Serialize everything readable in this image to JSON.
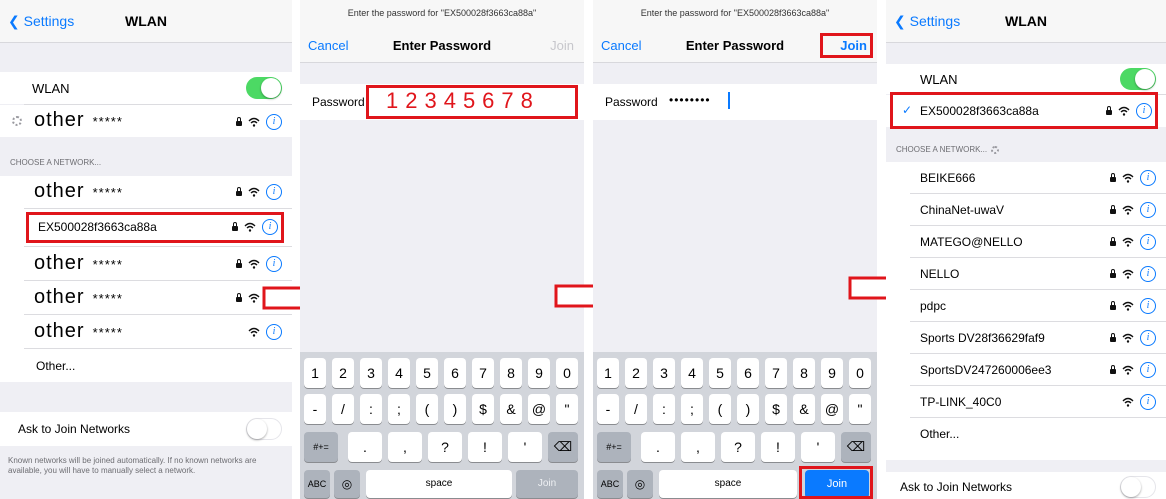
{
  "colors": {
    "accent": "#0a7aff",
    "switch_on": "#4cd964",
    "highlight": "#e0151b",
    "keyboard_bg": "#d2d5db"
  },
  "panel1": {
    "back_label": "Settings",
    "title": "WLAN",
    "wlan_label": "WLAN",
    "current_network_word": "other",
    "current_network_stars": "*****",
    "section_label": "CHOOSE A NETWORK...",
    "networks": [
      {
        "word": "other",
        "stars": "*****"
      },
      {
        "name": "EX500028f3663ca88a"
      },
      {
        "word": "other",
        "stars": "*****"
      },
      {
        "word": "other",
        "stars": "*****"
      },
      {
        "word": "other",
        "stars": "*****"
      }
    ],
    "other_label": "Other...",
    "ask_join_label": "Ask to Join Networks",
    "footnote": "Known networks will be joined automatically. If no known networks are available, you will have to manually select a network."
  },
  "panel2": {
    "prompt": "Enter the password for \"EX500028f3663ca88a\"",
    "cancel_label": "Cancel",
    "title": "Enter Password",
    "join_label": "Join",
    "password_label": "Password",
    "password_value": "12345678",
    "keys_row1": [
      "1",
      "2",
      "3",
      "4",
      "5",
      "6",
      "7",
      "8",
      "9",
      "0"
    ],
    "keys_row2": [
      "-",
      "/",
      ":",
      ";",
      "(",
      ")",
      "$",
      "&",
      "@",
      "\""
    ],
    "keys_row3": [
      ".",
      ",",
      "?",
      "!",
      "'"
    ],
    "symbols_key": "#+=",
    "abc_key": "ABC",
    "space_key": "space",
    "join_key": "Join"
  },
  "panel3": {
    "prompt": "Enter the password for \"EX500028f3663ca88a\"",
    "cancel_label": "Cancel",
    "title": "Enter Password",
    "join_label": "Join",
    "password_label": "Password",
    "password_masked": "••••••••",
    "keys_row1": [
      "1",
      "2",
      "3",
      "4",
      "5",
      "6",
      "7",
      "8",
      "9",
      "0"
    ],
    "keys_row2": [
      "-",
      "/",
      ":",
      ";",
      "(",
      ")",
      "$",
      "&",
      "@",
      "\""
    ],
    "keys_row3": [
      ".",
      ",",
      "?",
      "!",
      "'"
    ],
    "symbols_key": "#+=",
    "abc_key": "ABC",
    "space_key": "space",
    "join_key": "Join"
  },
  "panel4": {
    "back_label": "Settings",
    "title": "WLAN",
    "wlan_label": "WLAN",
    "checkmark": "✓",
    "connected_network": "EX500028f3663ca88a",
    "section_label": "CHOOSE A NETWORK...",
    "networks": [
      {
        "name": "BEIKE666",
        "locked": true
      },
      {
        "name": "ChinaNet-uwaV",
        "locked": true
      },
      {
        "name": "MATEGO@NELLO",
        "locked": true
      },
      {
        "name": "NELLO",
        "locked": true
      },
      {
        "name": "pdpc",
        "locked": true
      },
      {
        "name": "Sports DV28f36629faf9",
        "locked": true
      },
      {
        "name": "SportsDV247260006ee3",
        "locked": true
      },
      {
        "name": "TP-LINK_40C0",
        "locked": false
      }
    ],
    "other_label": "Other...",
    "ask_join_label": "Ask to Join Networks"
  }
}
